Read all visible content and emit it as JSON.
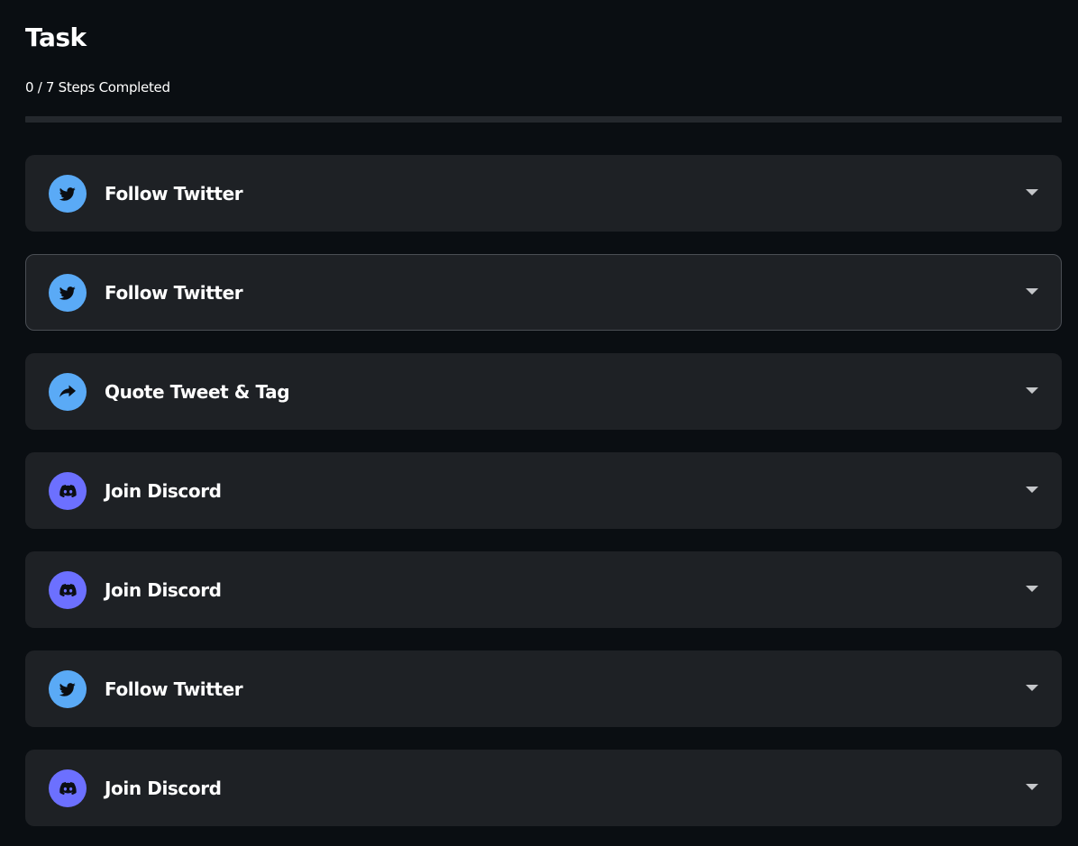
{
  "header": {
    "title": "Task",
    "progress_text": "0 / 7 Steps Completed",
    "progress_fraction": 0
  },
  "colors": {
    "background": "#0a0e12",
    "card": "#1e2125",
    "twitter": "#5aaaf6",
    "discord": "#6c70ff"
  },
  "tasks": [
    {
      "label": "Follow Twitter",
      "icon": "twitter-bird-icon"
    },
    {
      "label": "Follow Twitter",
      "icon": "twitter-bird-icon"
    },
    {
      "label": "Quote Tweet & Tag",
      "icon": "share-arrow-icon"
    },
    {
      "label": "Join Discord",
      "icon": "discord-icon"
    },
    {
      "label": "Join Discord",
      "icon": "discord-icon"
    },
    {
      "label": "Follow Twitter",
      "icon": "twitter-bird-icon"
    },
    {
      "label": "Join Discord",
      "icon": "discord-icon"
    }
  ]
}
